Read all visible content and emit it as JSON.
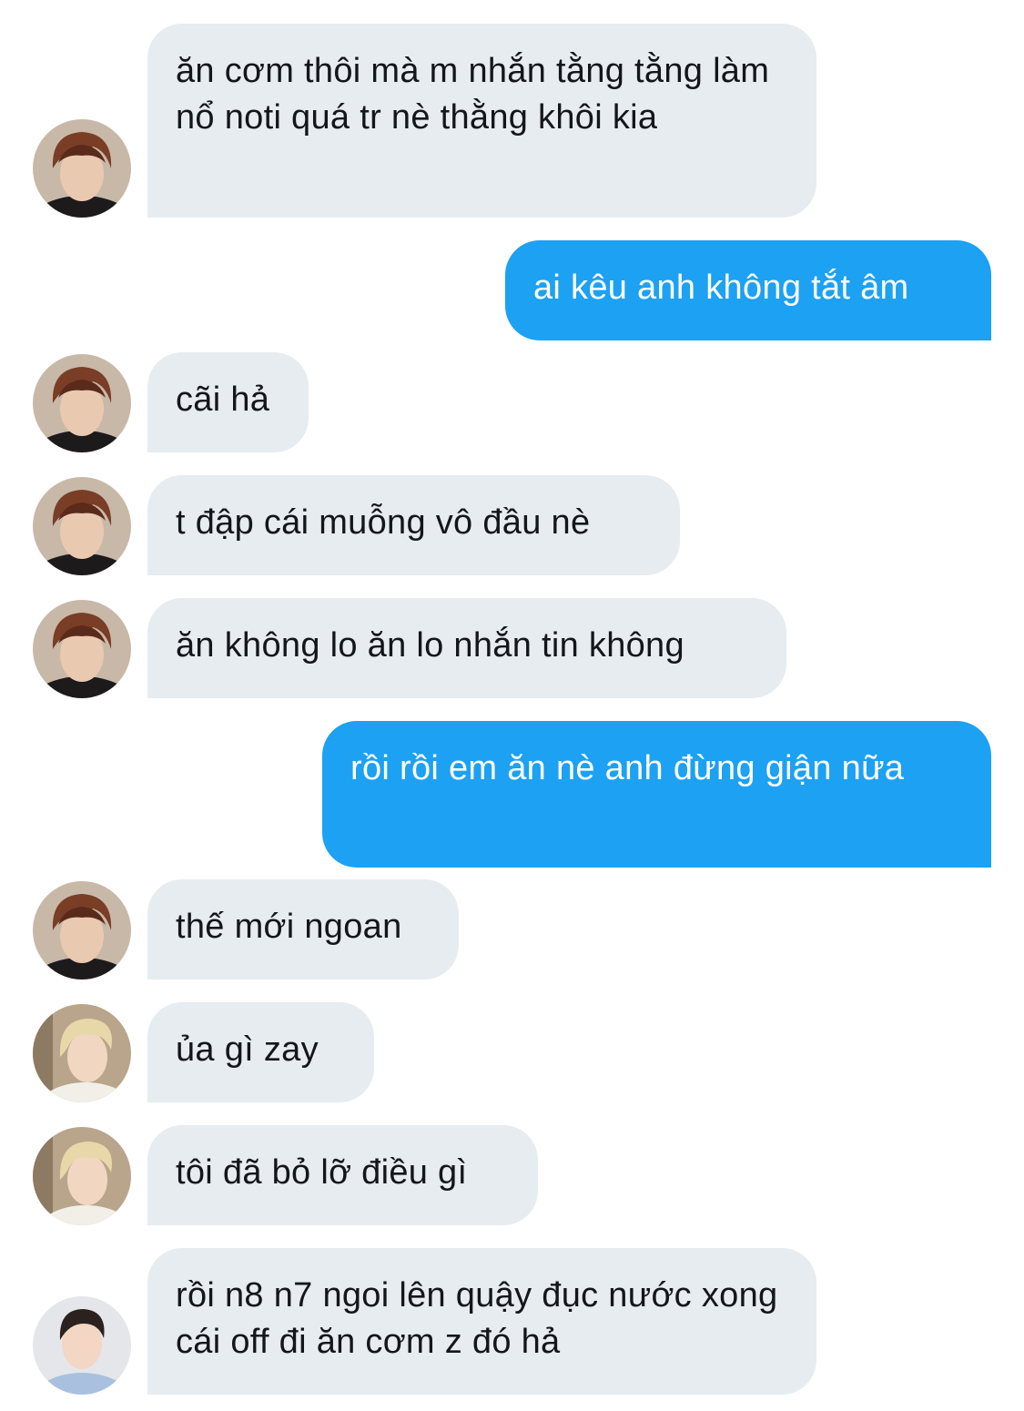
{
  "conversation": {
    "messages": [
      {
        "text": "ăn cơm thôi mà m nhắn tằng tằng làm nổ noti quá tr nè thằng khôi kia"
      },
      {
        "text": "ai kêu anh không tắt âm"
      },
      {
        "text": "cãi hả"
      },
      {
        "text": "t đập cái muỗng vô đầu nè"
      },
      {
        "text": "ăn không lo ăn lo nhắn tin không"
      },
      {
        "text": "rồi rồi em ăn nè anh đừng giận nữa"
      },
      {
        "text": "thế mới ngoan"
      },
      {
        "text": "ủa gì zay"
      },
      {
        "text": "tôi đã bỏ lỡ điều gì"
      },
      {
        "text": "rồi n8 n7 ngoi lên quậy đục nước xong cái off đi ăn cơm z đó hả"
      }
    ]
  },
  "colors": {
    "incoming_bubble": "#e6ecf0",
    "outgoing_bubble": "#1da1f2",
    "incoming_text": "#14171a",
    "outgoing_text": "#ffffff"
  }
}
